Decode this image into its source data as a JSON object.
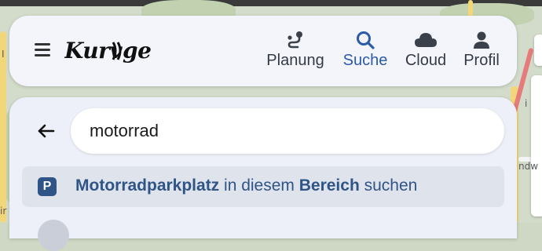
{
  "app": {
    "logo_text": "Kurviger"
  },
  "nav": {
    "items": [
      {
        "key": "planung",
        "label": "Planung",
        "icon": "route-icon",
        "active": false
      },
      {
        "key": "suche",
        "label": "Suche",
        "icon": "search-icon",
        "active": true
      },
      {
        "key": "cloud",
        "label": "Cloud",
        "icon": "cloud-icon",
        "active": false
      },
      {
        "key": "profil",
        "label": "Profil",
        "icon": "person-icon",
        "active": false
      }
    ]
  },
  "search": {
    "value": "motorrad",
    "placeholder": ""
  },
  "suggestion": {
    "badge": "P",
    "category": "Motorradparkplatz",
    "middle": " in diesem ",
    "area": "Bereich",
    "suffix": " suchen"
  },
  "map": {
    "labels": [
      "I",
      "ndw",
      "ir",
      "i"
    ]
  },
  "colors": {
    "accent": "#2b5aa8",
    "suggestion_text": "#2f5486",
    "header_bg": "#f3f5fb",
    "panel_bg": "#edf0f8"
  }
}
